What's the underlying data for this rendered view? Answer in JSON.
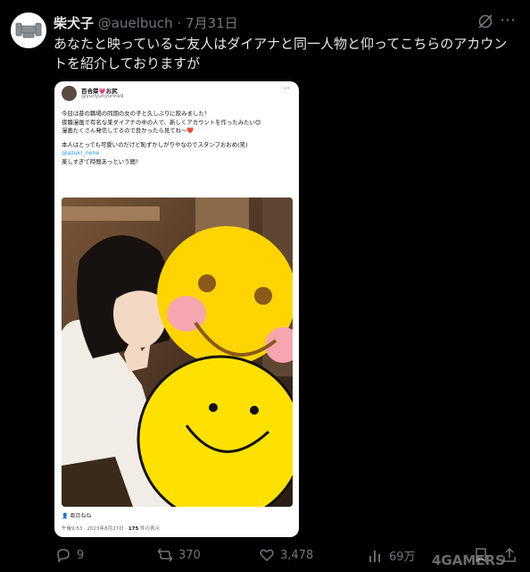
{
  "post": {
    "display_name": "柴犬子",
    "handle": "@auelbuch",
    "separator": "·",
    "date": "7月31日",
    "text": "あなたと映っているご友人はダイアナと同一人物と仰ってこちらのアカウントを紹介しておりますが"
  },
  "embedded_post": {
    "display_name": "百合菜💗お尻",
    "handle": "@yuriyuriyurina9",
    "lines": [
      "今日は昔の職場の同期の女の子と久しぶりに飲みました！",
      "夜職漫画で有名な某ダイアナの中の人で、新しくアカウントを作ったみたい😊",
      "漫画たくさん発信してるので良かったら見てね〜❤️",
      "本人はとっても可愛いのだけど恥ずかしがりやなのでスタンプおおめ(笑)"
    ],
    "mention": "@azuki_nene",
    "last_line": "楽しすぎて時間あっという間！",
    "photo_credit": "亜月ねね",
    "meta_time": "午後9:53 · 2023年8月27日 · ",
    "meta_views": "175",
    "meta_views_label": " 件の表示"
  },
  "actions": {
    "replies": "9",
    "reposts": "370",
    "likes": "3,478",
    "views": "69万"
  },
  "watermark": "4GAMERS",
  "icons": {
    "more": "more-icon",
    "grok": "grok-icon",
    "reply": "reply-icon",
    "repost": "repost-icon",
    "like": "heart-icon",
    "views": "analytics-icon",
    "bookmark": "bookmark-icon",
    "share": "share-icon"
  },
  "colors": {
    "background": "#000000",
    "text": "#e7e9ea",
    "muted": "#71767b",
    "link": "#1d9bf0",
    "smiley": "#ffd400"
  }
}
